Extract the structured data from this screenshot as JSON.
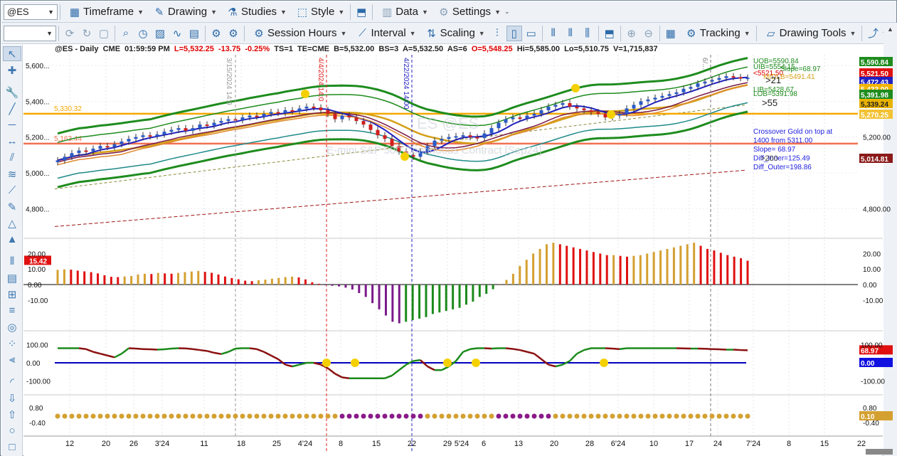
{
  "toolbar1": {
    "symbol": "@ES",
    "items": [
      {
        "icon": "calendar-icon",
        "label": "Timeframe"
      },
      {
        "icon": "pencil-icon",
        "label": "Drawing"
      },
      {
        "icon": "flask-icon",
        "label": "Studies"
      },
      {
        "icon": "style-icon",
        "label": "Style"
      },
      {
        "icon": "layout-icon",
        "label": ""
      },
      {
        "icon": "data-icon",
        "label": "Data"
      },
      {
        "icon": "gear-icon",
        "label": "Settings"
      }
    ]
  },
  "toolbar2": {
    "dropdown_value": "",
    "session_hours": "Session Hours",
    "interval": "Interval",
    "scaling": "Scaling",
    "tracking": "Tracking",
    "drawing_tools": "Drawing Tools"
  },
  "chart_header": {
    "symbol": "@ES - Daily",
    "exchange": "CME",
    "time": "01:59:59 PM",
    "last": "L=5,532.25",
    "change": "-13.75",
    "pct": "-0.25%",
    "ts": "TS=1",
    "te": "TE=CME",
    "bid": "B=5,532.00",
    "bs": "BS=3",
    "ask": "A=5,532.50",
    "as": "AS=6",
    "open": "O=5,548.25",
    "hi": "Hi=5,585.00",
    "lo": "Lo=5,510.75",
    "vol": "V=1,715,837"
  },
  "watermark": {
    "line1": "ES @ES",
    "line2": "E-mini S&P 500 Continuous Contract [Sep24]"
  },
  "chart_data": [
    {
      "type": "candlestick",
      "title": "@ES - Daily",
      "description": "E-mini S&P 500 Continuous Contract [Sep24]",
      "ylim": [
        4650,
        5660
      ],
      "y_ticks": [
        "5,600...",
        "5,400...",
        "5,200...",
        "5,000...",
        "4,800..."
      ],
      "y_ticks_right": [
        "5,200.00",
        "4,800.00"
      ],
      "x_ticks": [
        "12",
        "20",
        "26",
        "3'24",
        "11",
        "18",
        "25",
        "4'24",
        "8",
        "15",
        "22",
        "29",
        "5'24",
        "6",
        "13",
        "20",
        "28",
        "6'24",
        "10",
        "17",
        "24",
        "7'24",
        "8",
        "15",
        "22"
      ],
      "horizontal_lines": [
        {
          "value": 5330.32,
          "label": "5,330.32",
          "color": "#f5a800"
        },
        {
          "value": 5163.44,
          "label": "5,163.44",
          "color": "#f07050"
        }
      ],
      "vertical_markers": [
        "3/15/2024 14:0",
        "4/4/2024 14:0",
        "4/22/2024 14:00",
        "6/..."
      ],
      "band_labels": [
        {
          "text": "UOB=5590.84",
          "color": "#1e8c1e"
        },
        {
          "text": "UIB=5554.15",
          "color": "#1e8c1e"
        },
        {
          "text": "Slope=68.97",
          "color": "#1e8c1e"
        },
        {
          "text": "<5521.50",
          "color": "#e00000"
        },
        {
          "text": "MIDLB=5491.41",
          "color": "#d4a017"
        },
        {
          "text": ">21",
          "color": "#222222"
        },
        {
          "text": "LIB=5428.67",
          "color": "#1e8c1e"
        },
        {
          "text": "LOB=5391.98",
          "color": "#1e8c1e"
        },
        {
          "text": ">55",
          "color": "#222222"
        }
      ],
      "annotation": [
        "Crossover Gold on top at",
        "1400 from 5311.00",
        "Slope= 68.97",
        "Diff_Inner=125.49",
        "Diff_Outer=198.86"
      ],
      "annotation_overlay": ">200",
      "price_badges": [
        {
          "text": "5,590.84",
          "bg": "#1e8c1e",
          "fg": "#ffffff"
        },
        {
          "text": "5,521.50",
          "bg": "#e01010",
          "fg": "#ffffff"
        },
        {
          "text": "5,472.43",
          "bg": "#2020c0",
          "fg": "#ffffff"
        },
        {
          "text": "5,433.00",
          "bg": "#f2b400",
          "fg": "#ffffff"
        },
        {
          "text": "5,391.98",
          "bg": "#1e8c1e",
          "fg": "#ffffff"
        },
        {
          "text": "5,339.24",
          "bg": "#e9b200",
          "fg": "#222222"
        },
        {
          "text": "5,270.25",
          "bg": "#f3c234",
          "fg": "#ffffff"
        },
        {
          "text": "5,014.81",
          "bg": "#8b1a1a",
          "fg": "#ffffff"
        }
      ],
      "price_badge_values": [
        5590.84,
        5521.5,
        5472.43,
        5433.0,
        5391.98,
        5339.24,
        5270.25,
        5014.81
      ],
      "closes": [
        5070,
        5090,
        5110,
        5125,
        5120,
        5135,
        5150,
        5145,
        5160,
        5175,
        5190,
        5200,
        5210,
        5205,
        5215,
        5230,
        5240,
        5250,
        5235,
        5250,
        5270,
        5265,
        5280,
        5290,
        5300,
        5295,
        5310,
        5320,
        5315,
        5330,
        5340,
        5335,
        5350,
        5345,
        5360,
        5370,
        5365,
        5350,
        5330,
        5300,
        5320,
        5310,
        5290,
        5270,
        5240,
        5210,
        5190,
        5150,
        5120,
        5100,
        5090,
        5120,
        5150,
        5180,
        5190,
        5200,
        5205,
        5210,
        5200,
        5195,
        5220,
        5250,
        5280,
        5300,
        5310,
        5305,
        5320,
        5330,
        5350,
        5370,
        5380,
        5390,
        5370,
        5360,
        5350,
        5340,
        5330,
        5310,
        5320,
        5330,
        5360,
        5380,
        5400,
        5410,
        5420,
        5430,
        5440,
        5450,
        5470,
        5480,
        5500,
        5510,
        5520,
        5530,
        5540,
        5535,
        5530,
        5532
      ]
    },
    {
      "type": "histogram",
      "ylim": [
        -28,
        28
      ],
      "y_ticks": [
        "20.00",
        "10.00",
        "0.00",
        "-10.00"
      ],
      "last_badge": "15.42",
      "values": [
        9.5,
        9.8,
        9.6,
        9,
        8.5,
        8,
        7.2,
        6,
        5,
        4.8,
        5.2,
        5.5,
        6.5,
        7,
        6.8,
        7.5,
        7.2,
        7,
        7.5,
        8,
        8.4,
        8.8,
        8.2,
        7.6,
        6.5,
        5.2,
        4.2,
        3.4,
        2.5,
        2.2,
        2.8,
        3.2,
        3.8,
        4.3,
        4.8,
        5.1,
        4.6,
        3.3,
        1.5,
        0.5,
        -0.4,
        -0.8,
        -1.2,
        -2,
        -3.2,
        -5.5,
        -8,
        -12,
        -16,
        -20,
        -24,
        -25,
        -24,
        -23,
        -22,
        -21,
        -19,
        -18,
        -17,
        -16,
        -15,
        -13,
        -11,
        -8,
        -6,
        -3,
        0.3,
        3,
        7,
        12,
        16,
        20,
        23,
        26,
        27,
        26,
        25,
        24,
        23,
        22,
        21,
        20,
        19,
        19,
        18.5,
        18,
        18.5,
        19,
        20,
        21,
        22,
        23,
        24,
        25,
        26,
        27,
        25,
        23,
        22,
        20.5,
        19,
        18,
        17,
        15.4
      ],
      "colors": "gold-rising/red-falling positive; green-rising/purple-falling negative"
    },
    {
      "type": "line",
      "ylim": [
        -160,
        160
      ],
      "y_ticks": [
        "100.00",
        "0.00",
        "-100.00"
      ],
      "right_ticks": [
        "100.00",
        "-100.00"
      ],
      "last_badge": "68.97",
      "zero_badge": "0.00",
      "values": [
        80,
        80,
        80,
        80,
        75,
        60,
        50,
        40,
        30,
        50,
        80,
        78,
        75,
        74,
        72,
        74,
        78,
        80,
        79,
        75,
        70,
        65,
        55,
        48,
        60,
        78,
        80,
        80,
        75,
        60,
        40,
        20,
        -10,
        -20,
        -10,
        0,
        0,
        -10,
        -30,
        -60,
        -80,
        -85,
        -85,
        -85,
        -85,
        -85,
        -85,
        -70,
        -40,
        -10,
        10,
        15,
        -20,
        -40,
        -40,
        -20,
        10,
        60,
        75,
        80,
        80,
        78,
        80,
        80,
        76,
        70,
        60,
        50,
        20,
        -10,
        -20,
        -10,
        10,
        50,
        70,
        80,
        80,
        80,
        78,
        75,
        80,
        80,
        80,
        80,
        80,
        80,
        80,
        80,
        79,
        78,
        78,
        77,
        75,
        74,
        72,
        72,
        70,
        69
      ]
    },
    {
      "type": "dots",
      "y_ticks": [
        "0.80",
        "-0.40"
      ],
      "last_badge": "0.10"
    }
  ]
}
